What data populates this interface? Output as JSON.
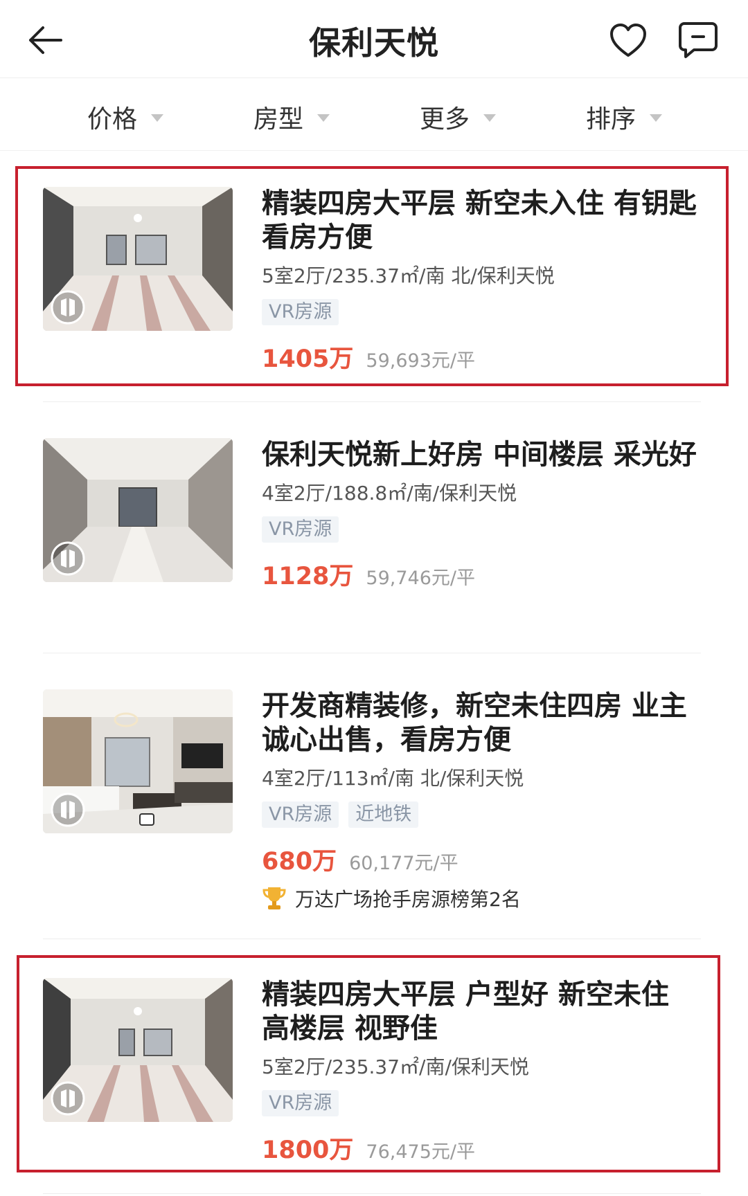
{
  "header": {
    "title": "保利天悦",
    "back_icon": "arrow-left-icon",
    "favorite_icon": "heart-icon",
    "message_icon": "chat-icon"
  },
  "filters": [
    {
      "label": "价格"
    },
    {
      "label": "房型"
    },
    {
      "label": "更多"
    },
    {
      "label": "排序"
    }
  ],
  "listings": [
    {
      "title": "精装四房大平层 新空未入住 有钥匙 看房方便",
      "meta": "5室2厅/235.37㎡/南 北/保利天悦",
      "tags": [
        "VR房源"
      ],
      "price": "1405万",
      "unit_price": "59,693元/平",
      "highlighted": true
    },
    {
      "title": "保利天悦新上好房 中间楼层 采光好",
      "meta": "4室2厅/188.8㎡/南/保利天悦",
      "tags": [
        "VR房源"
      ],
      "price": "1128万",
      "unit_price": "59,746元/平",
      "highlighted": false
    },
    {
      "title": "开发商精装修，新空未住四房 业主诚心出售，看房方便",
      "meta": "4室2厅/113㎡/南 北/保利天悦",
      "tags": [
        "VR房源",
        "近地铁"
      ],
      "price": "680万",
      "unit_price": "60,177元/平",
      "rank_text": "万达广场抢手房源榜第2名",
      "highlighted": false
    },
    {
      "title": "精装四房大平层 户型好 新空未住 高楼层 视野佳",
      "meta": "5室2厅/235.37㎡/南/保利天悦",
      "tags": [
        "VR房源"
      ],
      "price": "1800万",
      "unit_price": "76,475元/平",
      "highlighted": true
    }
  ],
  "colors": {
    "price": "#e8553e",
    "highlight_border": "#c7202e",
    "tag_bg": "#f1f4f7",
    "tag_text": "#8a96a6"
  }
}
